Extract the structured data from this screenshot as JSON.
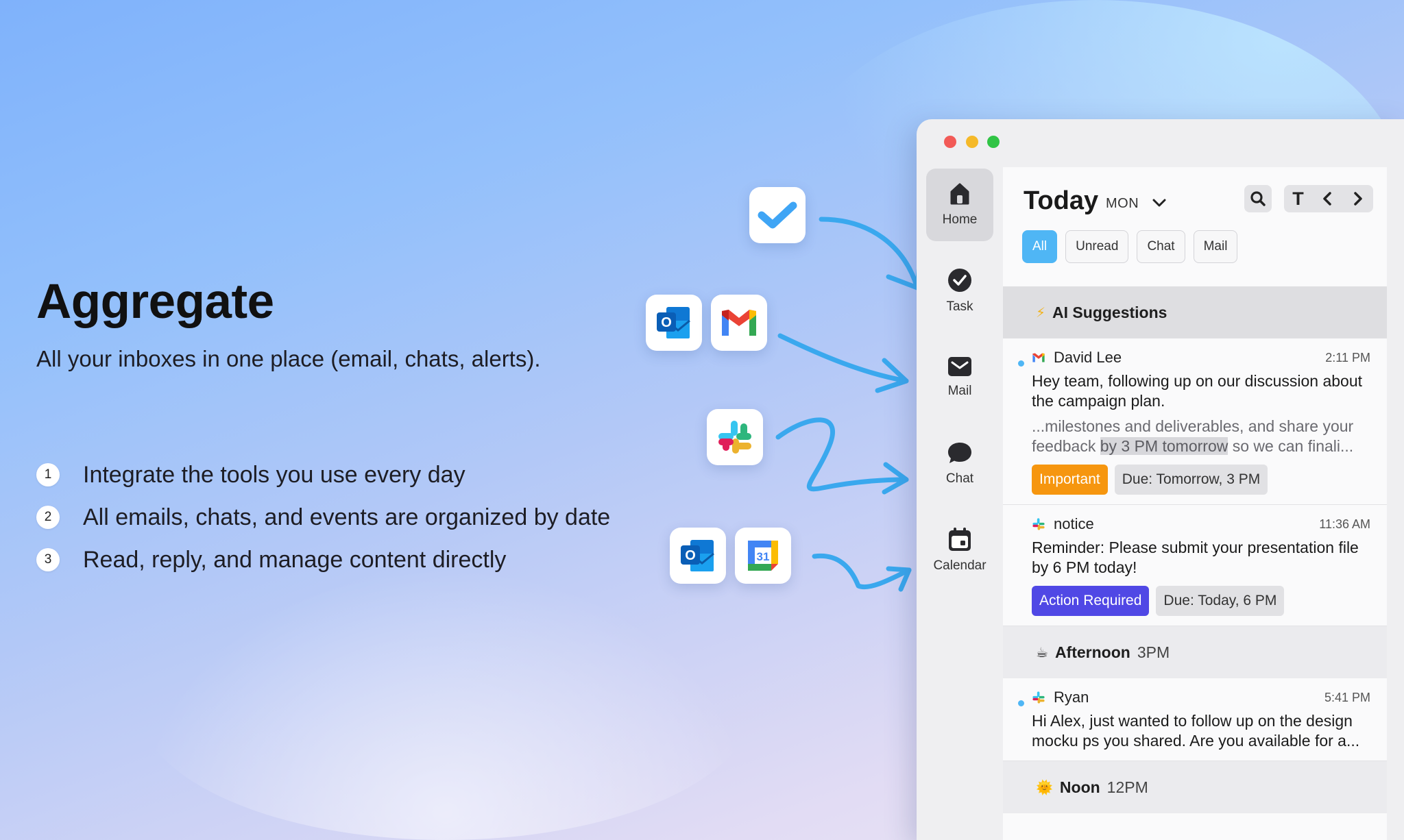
{
  "hero": {
    "title": "Aggregate",
    "subtitle": "All your inboxes in one place (email, chats, alerts).",
    "features": [
      {
        "num": "1",
        "text": "Integrate the tools you use every day"
      },
      {
        "num": "2",
        "text": "All emails, chats, and events are organized by date"
      },
      {
        "num": "3",
        "text": "Read, reply, and manage content directly"
      }
    ]
  },
  "integrations": [
    "checkmark-app-icon",
    "outlook-icon",
    "gmail-icon",
    "slack-icon",
    "outlook-icon",
    "google-calendar-icon"
  ],
  "calendar_icon_day": "31",
  "outlook_letter": "O",
  "colors": {
    "accent": "#4fb6f5",
    "important": "#f6960f",
    "action": "#5048e5"
  },
  "sidebar": {
    "items": [
      {
        "label": "Home",
        "icon": "home-icon"
      },
      {
        "label": "Task",
        "icon": "check-circle-icon"
      },
      {
        "label": "Mail",
        "icon": "mail-icon"
      },
      {
        "label": "Chat",
        "icon": "chat-bubble-icon"
      },
      {
        "label": "Calendar",
        "icon": "calendar-icon"
      }
    ]
  },
  "header": {
    "title": "Today",
    "day": "MON",
    "text_tool": "T",
    "filters": [
      "All",
      "Unread",
      "Chat",
      "Mail"
    ]
  },
  "sections": {
    "ai": {
      "emoji": "⚡",
      "title": "AI Suggestions"
    },
    "afternoon": {
      "emoji": "☕",
      "title": "Afternoon",
      "time": "3PM"
    },
    "noon": {
      "emoji": "🌞",
      "title": "Noon",
      "time": "12PM"
    }
  },
  "messages": [
    {
      "sender": "David Lee",
      "time": "2:11 PM",
      "body": "Hey team, following up on our discussion about the campaign plan.",
      "snippet_pre": "...milestones and deliverables, and share your feedback ",
      "snippet_hl": "by 3 PM tomorrow",
      "snippet_post": " so we can finali...",
      "tags": [
        "Important",
        "Due: Tomorrow, 3 PM"
      ]
    },
    {
      "sender": "notice",
      "time": "11:36 AM",
      "body": "Reminder: Please submit your presentation file by 6 PM today!",
      "tags": [
        "Action Required",
        "Due: Today, 6 PM"
      ]
    },
    {
      "sender": "Ryan",
      "time": "5:41 PM",
      "body": "Hi Alex, just wanted to follow up on the design mocku ps you shared. Are you available for a..."
    }
  ]
}
